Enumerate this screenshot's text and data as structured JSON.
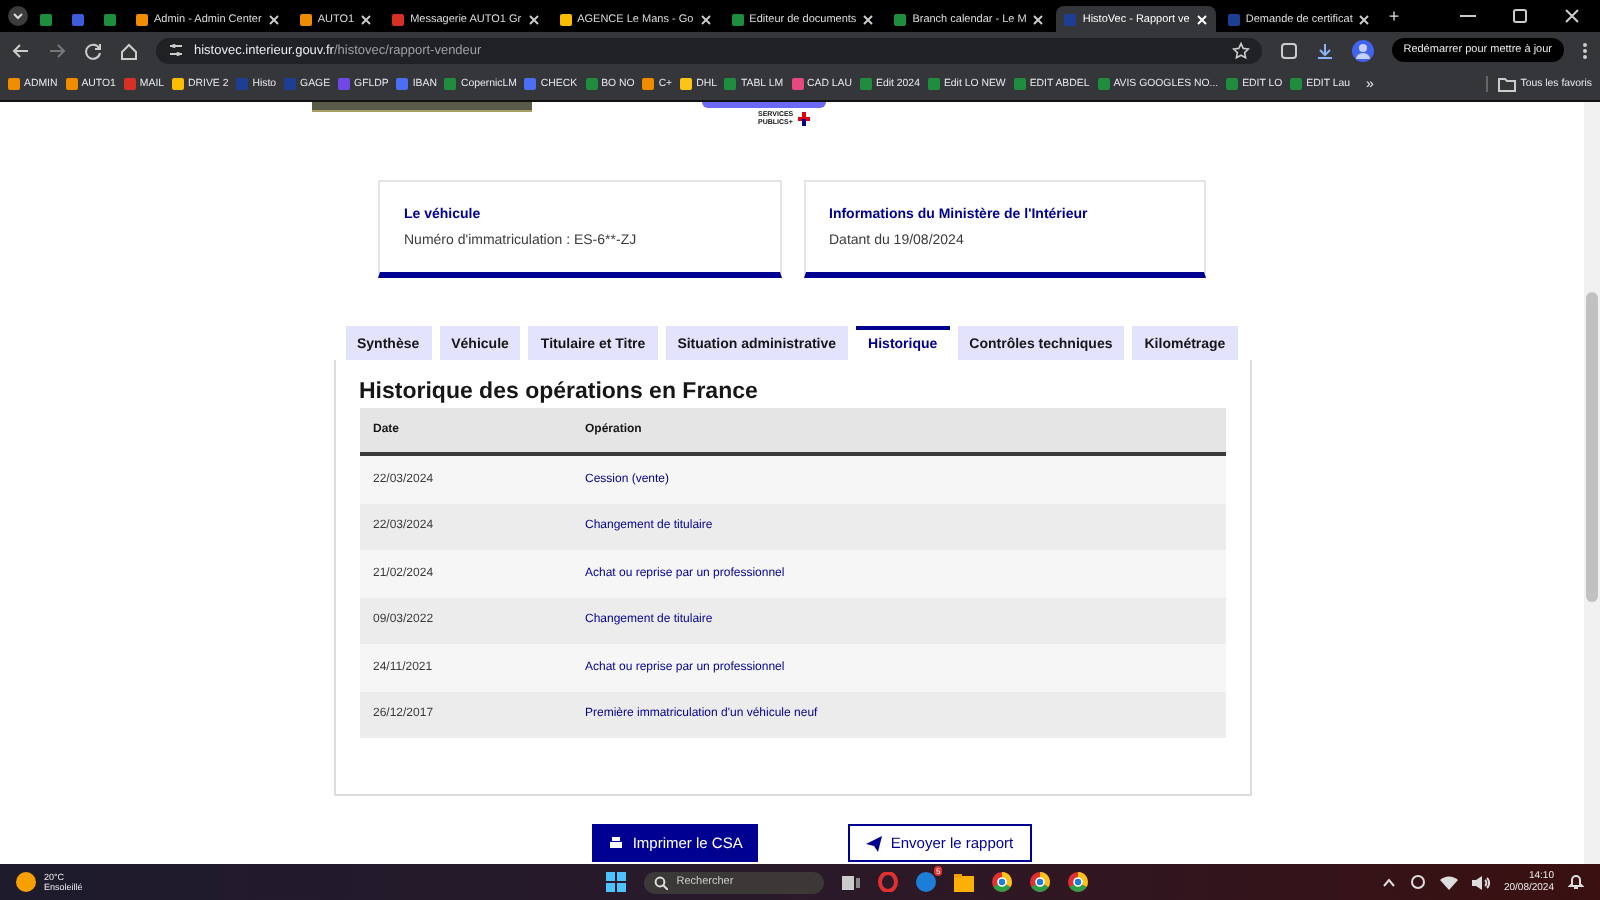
{
  "browser_tabs": [
    {
      "color": "#1e8e3e",
      "selected": false
    },
    {
      "color": "#3b5bdb",
      "selected": false
    },
    {
      "color": "#1e8e3e",
      "selected": false
    },
    {
      "title": "Admin - Admin Center",
      "color": "#f08c00",
      "selected": false
    },
    {
      "title": "AUTO1",
      "color": "#f08c00",
      "selected": false
    },
    {
      "title": "Messagerie AUTO1 Gr",
      "color": "#d93025",
      "selected": false
    },
    {
      "title": "AGENCE Le Mans - Go",
      "color": "#fbbc04",
      "selected": false
    },
    {
      "title": "Editeur de documents",
      "color": "#1e8e3e",
      "selected": false
    },
    {
      "title": "Branch calendar - Le M",
      "color": "#1e8e3e",
      "selected": false
    },
    {
      "title": "HistoVec - Rapport ve",
      "color": "#1c3f94",
      "selected": true
    },
    {
      "title": "Demande de certificat",
      "color": "#1c3f94",
      "selected": false
    }
  ],
  "new_tab": "+",
  "address": {
    "domain": "histovec.interieur.gouv.fr",
    "path": "/histovec/rapport-vendeur"
  },
  "restart_button": "Redémarrer pour mettre à jour",
  "bookmarks": [
    {
      "label": "ADMIN",
      "color": "#f08c00"
    },
    {
      "label": "AUTO1",
      "color": "#f08c00"
    },
    {
      "label": "MAIL",
      "color": "#d93025"
    },
    {
      "label": "DRIVE 2",
      "color": "#fbbc04"
    },
    {
      "label": "Histo",
      "color": "#1c3f94"
    },
    {
      "label": "GAGE",
      "color": "#1c3f94"
    },
    {
      "label": "GFLDP",
      "color": "#7048e8"
    },
    {
      "label": "IBAN",
      "color": "#4c6ef5"
    },
    {
      "label": "CopernicLM",
      "color": "#1e8e3e"
    },
    {
      "label": "CHECK",
      "color": "#4c6ef5"
    },
    {
      "label": "BO NO",
      "color": "#1e8e3e"
    },
    {
      "label": "C+",
      "color": "#f08c00"
    },
    {
      "label": "DHL",
      "color": "#fcc419"
    },
    {
      "label": "TABL LM",
      "color": "#1e8e3e"
    },
    {
      "label": "CAD LAU",
      "color": "#e64980"
    },
    {
      "label": "Edit 2024",
      "color": "#1e8e3e"
    },
    {
      "label": "Edit LO NEW",
      "color": "#1e8e3e"
    },
    {
      "label": "EDIT ABDEL",
      "color": "#1e8e3e"
    },
    {
      "label": "AVIS GOOGLES NO...",
      "color": "#1e8e3e"
    },
    {
      "label": "EDIT LO",
      "color": "#1e8e3e"
    },
    {
      "label": "EDIT Lau",
      "color": "#1e8e3e"
    }
  ],
  "bookmarks_more": "»",
  "all_bookmarks": "Tous les favoris",
  "logo_text": "SERVICES PUBLICS+",
  "cards": [
    {
      "title": "Le véhicule",
      "text": "Numéro d'immatriculation : ES-6**-ZJ"
    },
    {
      "title": "Informations du Ministère de l'Intérieur",
      "text": "Datant du 19/08/2024"
    }
  ],
  "tabs": [
    {
      "label": "Synthèse",
      "selected": false
    },
    {
      "label": "Véhicule",
      "selected": false
    },
    {
      "label": "Titulaire et Titre",
      "selected": false
    },
    {
      "label": "Situation administrative",
      "selected": false
    },
    {
      "label": "Historique",
      "selected": true
    },
    {
      "label": "Contrôles techniques",
      "selected": false
    },
    {
      "label": "Kilométrage",
      "selected": false
    }
  ],
  "section_title": "Historique des opérations en France",
  "table": {
    "columns": [
      "Date",
      "Opération"
    ],
    "rows": [
      [
        "22/03/2024",
        "Cession (vente)"
      ],
      [
        "22/03/2024",
        "Changement de titulaire"
      ],
      [
        "21/02/2024",
        "Achat ou reprise par un professionnel"
      ],
      [
        "09/03/2022",
        "Changement de titulaire"
      ],
      [
        "24/11/2021",
        "Achat ou reprise par un professionnel"
      ],
      [
        "26/12/2017",
        "Première immatriculation d'un véhicule neuf"
      ]
    ]
  },
  "actions": [
    "Imprimer le CSA",
    "Envoyer le rapport"
  ],
  "taskbar": {
    "temperature": "20°C",
    "weather": "Ensoleillé",
    "search_placeholder": "Rechercher",
    "badge": "5",
    "time": "14:10",
    "date": "20/08/2024"
  }
}
